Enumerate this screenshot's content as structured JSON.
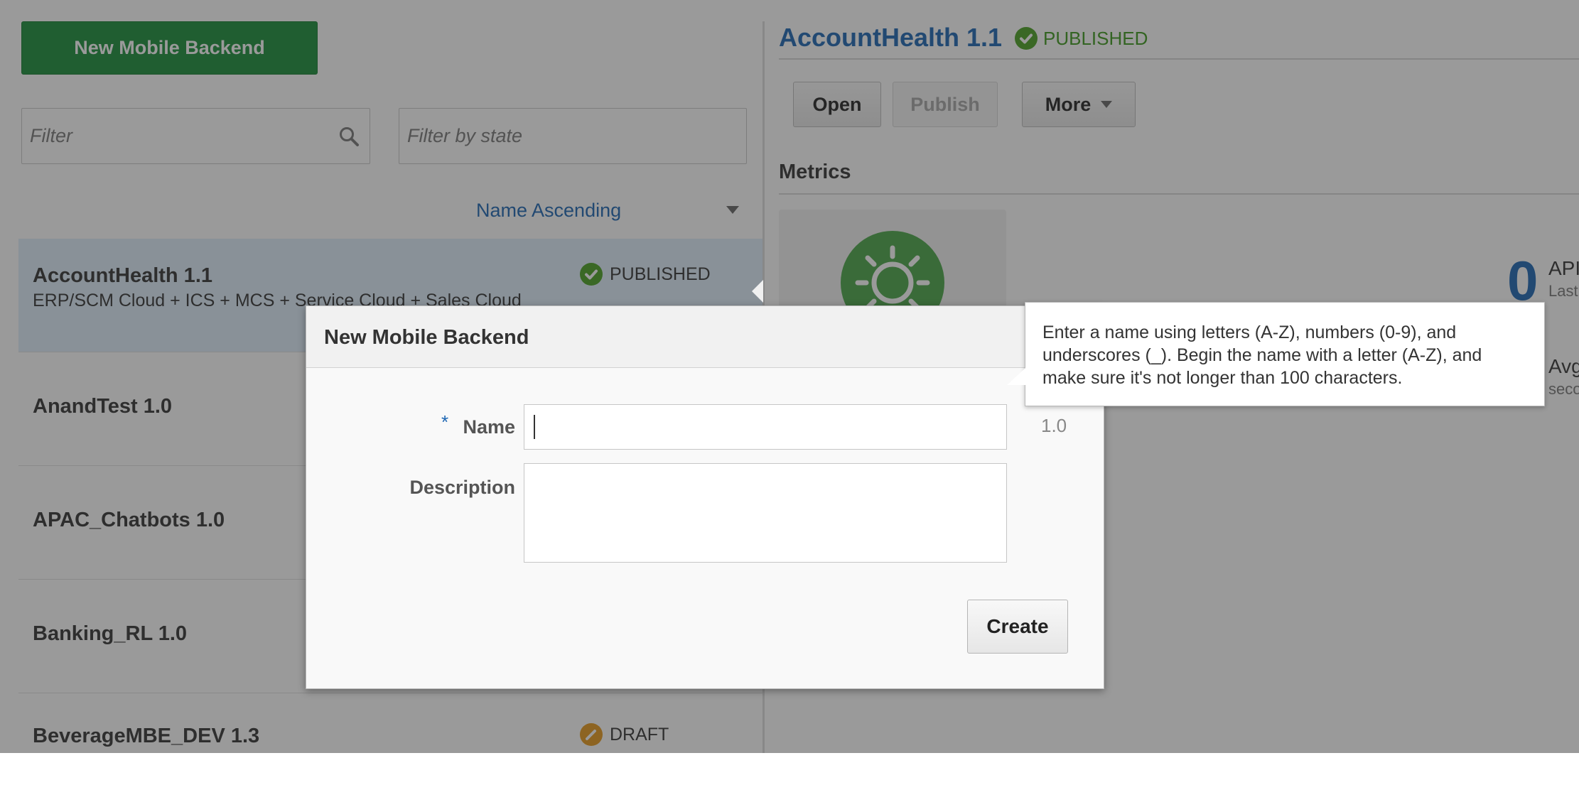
{
  "left": {
    "new_button": "New Mobile Backend",
    "filter_placeholder": "Filter",
    "state_placeholder": "Filter by state",
    "sort_label": "Name Ascending",
    "items": [
      {
        "title": "AccountHealth 1.1",
        "desc": "ERP/SCM Cloud + ICS + MCS + Service Cloud + Sales Cloud",
        "status": "PUBLISHED"
      },
      {
        "title": "AnandTest 1.0",
        "desc": "",
        "status": ""
      },
      {
        "title": "APAC_Chatbots 1.0",
        "desc": "",
        "status": ""
      },
      {
        "title": "Banking_RL 1.0",
        "desc": "",
        "status": ""
      },
      {
        "title": "BeverageMBE_DEV 1.3",
        "desc": "",
        "status": "DRAFT"
      }
    ]
  },
  "right": {
    "title": "AccountHealth 1.1",
    "status": "PUBLISHED",
    "buttons": {
      "open": "Open",
      "publish": "Publish",
      "more": "More"
    },
    "metrics_label": "Metrics",
    "api_count": "0",
    "api_label": "API",
    "api_sub": "Last",
    "avg_label": "Avg",
    "avg_sub": "seco"
  },
  "dialog": {
    "title": "New Mobile Backend",
    "required_mark": "*",
    "name_label": "Name",
    "description_label": "Description",
    "version": "1.0",
    "create_button": "Create",
    "tooltip": "Enter a name using letters (A-Z), numbers (0-9), and underscores (_). Begin the name with a letter (A-Z), and make sure it's not longer than 100 characters."
  },
  "colors": {
    "accent": "#1d66b3",
    "brand_green": "#1a8f3a",
    "published": "#4aa022",
    "draft": "#e69a1e"
  }
}
